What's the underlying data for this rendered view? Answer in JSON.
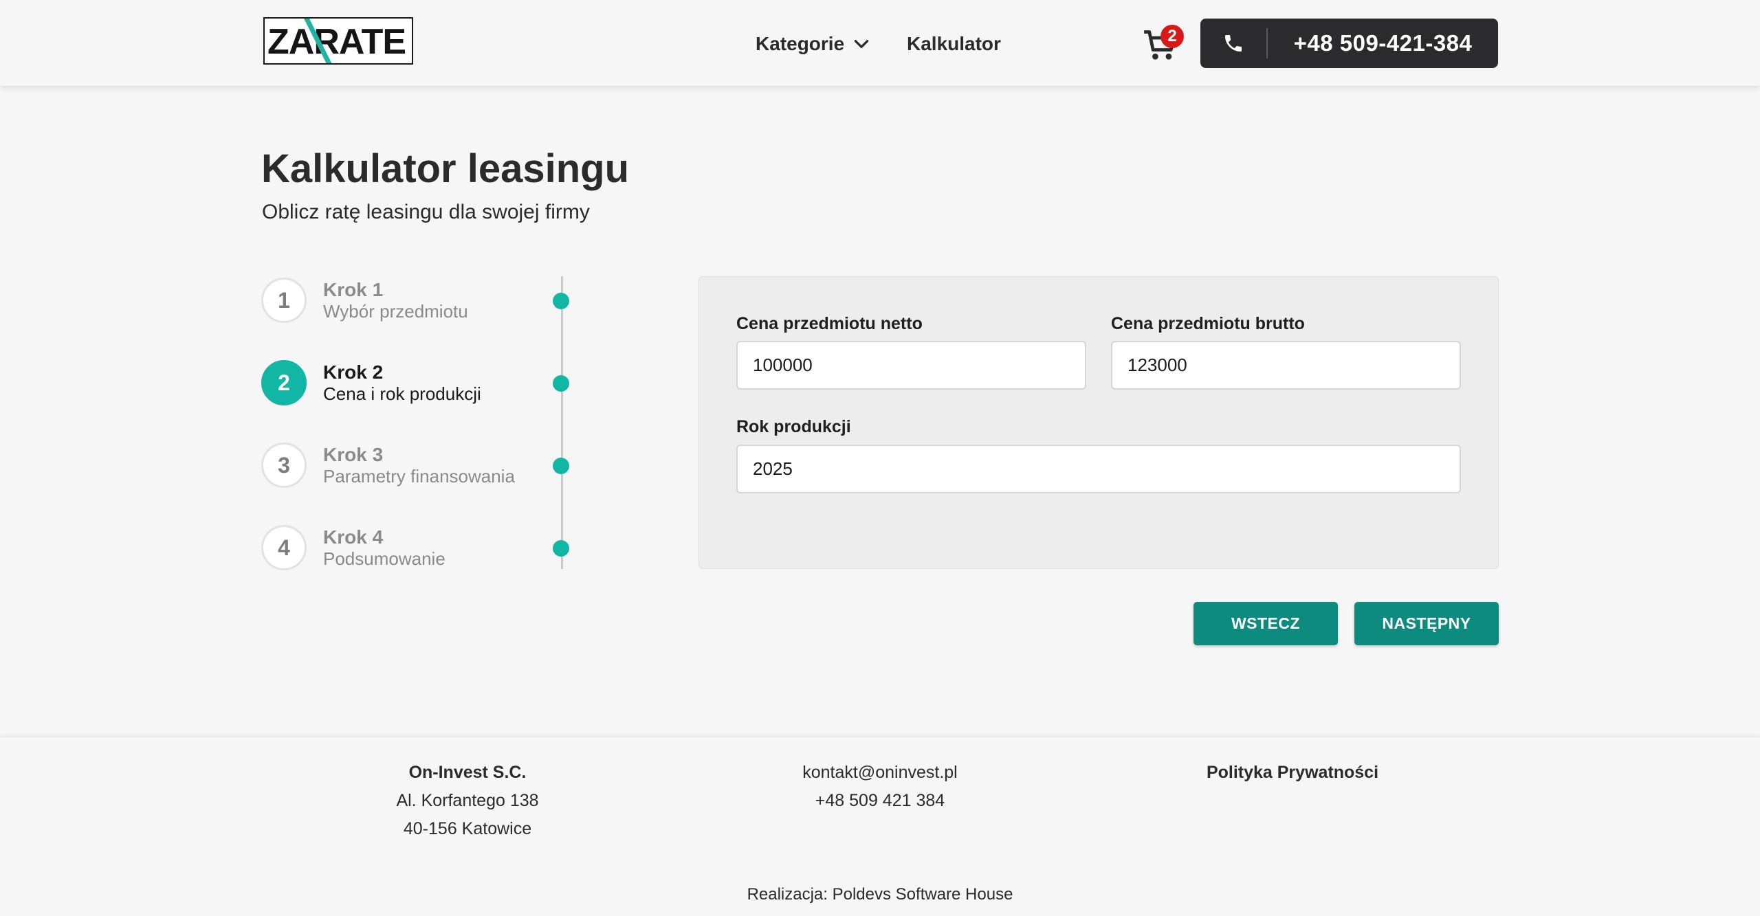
{
  "header": {
    "logo_text": "ZARATE",
    "nav": {
      "categories_label": "Kategorie",
      "calculator_label": "Kalkulator"
    },
    "cart_count": "2",
    "phone": "+48 509-421-384"
  },
  "page": {
    "title": "Kalkulator leasingu",
    "subtitle": "Oblicz ratę leasingu dla swojej firmy"
  },
  "stepper": {
    "steps": [
      {
        "num": "1",
        "title": "Krok 1",
        "desc": "Wybór przedmiotu"
      },
      {
        "num": "2",
        "title": "Krok 2",
        "desc": "Cena i rok produkcji"
      },
      {
        "num": "3",
        "title": "Krok 3",
        "desc": "Parametry finansowania"
      },
      {
        "num": "4",
        "title": "Krok 4",
        "desc": "Podsumowanie"
      }
    ]
  },
  "form": {
    "net_label": "Cena przedmiotu netto",
    "net_value": "100000",
    "gross_label": "Cena przedmiotu brutto",
    "gross_value": "123000",
    "year_label": "Rok produkcji",
    "year_value": "2025"
  },
  "buttons": {
    "back": "WSTECZ",
    "next": "NASTĘPNY"
  },
  "footer": {
    "company": "On-Invest S.C.",
    "address1": "Al. Korfantego 138",
    "address2": "40-156 Katowice",
    "email": "kontakt@oninvest.pl",
    "phone": "+48 509 421 384",
    "privacy": "Polityka Prywatności",
    "credit": "Realizacja: Poldevs Software House"
  },
  "colors": {
    "accent": "#12b6a5",
    "button": "#0c8b7e",
    "phone_button": "#2b2b2d",
    "badge": "#d71919"
  }
}
